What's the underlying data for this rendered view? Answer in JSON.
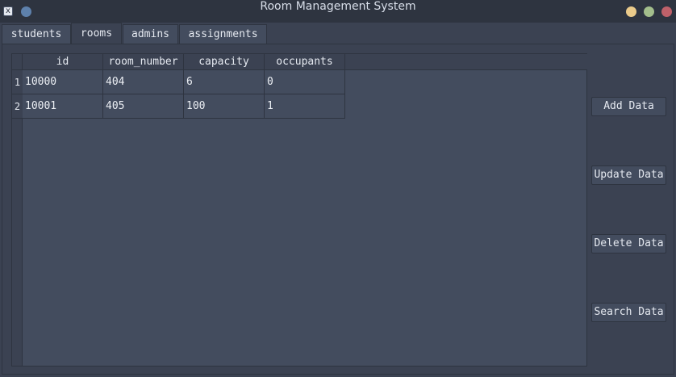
{
  "window": {
    "title": "Room Management System",
    "icons": [
      "app-icon",
      "pin-dot",
      "minimize",
      "maximize",
      "close"
    ]
  },
  "tabs": [
    {
      "label": "students"
    },
    {
      "label": "rooms"
    },
    {
      "label": "admins"
    },
    {
      "label": "assignments"
    }
  ],
  "active_tab": "rooms",
  "table": {
    "columns": [
      "id",
      "room_number",
      "capacity",
      "occupants"
    ],
    "rows": [
      {
        "num": "1",
        "cells": [
          "10000",
          "404",
          "6",
          "0"
        ]
      },
      {
        "num": "2",
        "cells": [
          "10001",
          "405",
          "100",
          "1"
        ]
      }
    ]
  },
  "buttons": {
    "add": "Add Data",
    "update": "Update Data",
    "delete": "Delete Data",
    "search": "Search Data"
  },
  "colors": {
    "background": "#3b4252",
    "titlebar": "#2e3440",
    "text": "#d8dee9",
    "close": "#bf616a",
    "maximize": "#a3be8c",
    "minimize": "#ebcb8b"
  }
}
